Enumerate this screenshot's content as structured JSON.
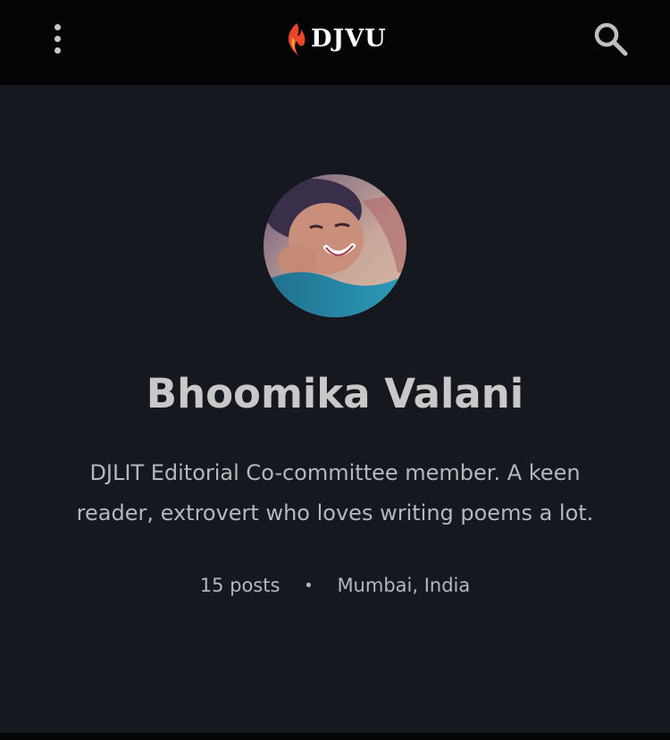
{
  "header": {
    "menu_icon": "more-vertical-icon",
    "logo_text": "DJVU",
    "logo_icon": "flame-icon",
    "search_icon": "search-icon"
  },
  "profile": {
    "avatar_alt": "avatar",
    "name": "Bhoomika Valani",
    "bio": "DJLIT Editorial Co-committee member. A keen reader, extrovert who loves writing poems a lot.",
    "posts": "15 posts",
    "separator": "•",
    "location": "Mumbai, India"
  },
  "colors": {
    "topbar": "#030405",
    "background": "#15191f",
    "name": "#c8c8c8",
    "text": "#b5b7ba",
    "logo_flame": "#e8452a"
  }
}
